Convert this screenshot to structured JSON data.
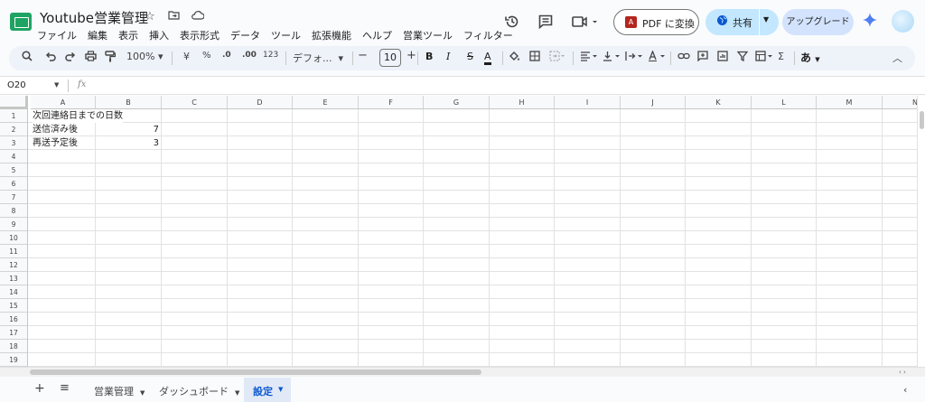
{
  "doc": {
    "title": "Youtube営業管理"
  },
  "menu": [
    "ファイル",
    "編集",
    "表示",
    "挿入",
    "表示形式",
    "データ",
    "ツール",
    "拡張機能",
    "ヘルプ",
    "営業ツール",
    "フィルター"
  ],
  "header": {
    "pdf_label": "PDF に変換",
    "pdf_icon_text": "A",
    "share_label": "共有",
    "upgrade_label": "アップグレード"
  },
  "toolbar": {
    "zoom": "100%",
    "currency": "¥",
    "percent": "%",
    "dec_decrease": ".0",
    "dec_increase": ".00",
    "number_format": "123",
    "font": "デフォ...",
    "font_size": "10",
    "bold": "B",
    "italic": "I",
    "strike": "S",
    "text_color": "A",
    "sum": "Σ",
    "input_tool": "あ"
  },
  "formula_bar": {
    "name_box": "O20",
    "fx": "fx",
    "value": ""
  },
  "columns": [
    "A",
    "B",
    "C",
    "D",
    "E",
    "F",
    "G",
    "H",
    "I",
    "J",
    "K",
    "L",
    "M",
    "N"
  ],
  "rows": [
    "1",
    "2",
    "3",
    "4",
    "5",
    "6",
    "7",
    "8",
    "9",
    "10",
    "11",
    "12",
    "13",
    "14",
    "15",
    "16",
    "17",
    "18",
    "19"
  ],
  "cells": {
    "A1": "次回連絡日までの日数",
    "A2": "送信済み後",
    "B2": "7",
    "A3": "再送予定後",
    "B3": "3"
  },
  "sheet_tabs": [
    {
      "label": "営業管理",
      "active": false
    },
    {
      "label": "ダッシュボード",
      "active": false
    },
    {
      "label": "設定",
      "active": true
    }
  ],
  "colors": {
    "accent": "#0b57d0",
    "share_bg": "#c2e7ff",
    "upgrade_bg": "#d3e3fd",
    "logo": "#1ea362",
    "pdf_icon": "#b3261e"
  }
}
